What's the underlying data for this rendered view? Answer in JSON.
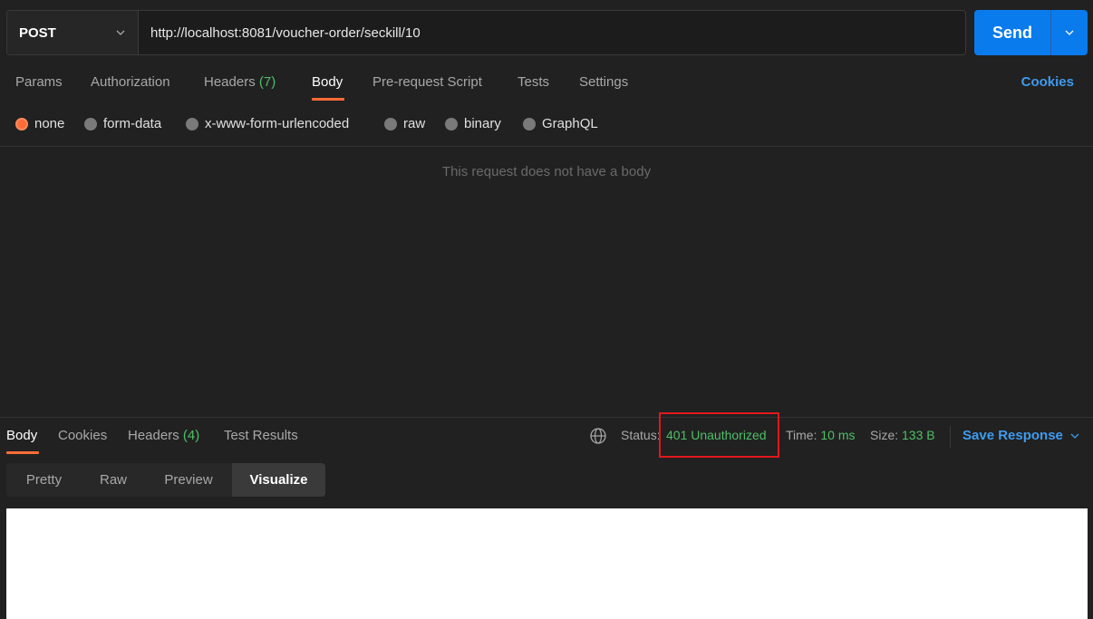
{
  "request": {
    "method": "POST",
    "url": "http://localhost:8081/voucher-order/seckill/10",
    "send_label": "Send"
  },
  "request_tabs": {
    "params": "Params",
    "authorization": "Authorization",
    "headers": "Headers",
    "headers_count": "(7)",
    "body": "Body",
    "prerequest": "Pre-request Script",
    "tests": "Tests",
    "settings": "Settings",
    "cookies": "Cookies"
  },
  "body_types": {
    "none": "none",
    "form_data": "form-data",
    "urlencoded": "x-www-form-urlencoded",
    "raw": "raw",
    "binary": "binary",
    "graphql": "GraphQL",
    "selected": "none"
  },
  "empty_body_message": "This request does not have a body",
  "response_tabs": {
    "body": "Body",
    "cookies": "Cookies",
    "headers": "Headers",
    "headers_count": "(4)",
    "test_results": "Test Results"
  },
  "response_meta": {
    "status_label": "Status:",
    "status_value": "401 Unauthorized",
    "time_label": "Time:",
    "time_value": "10 ms",
    "size_label": "Size:",
    "size_value": "133 B",
    "save_response": "Save Response"
  },
  "view_tabs": {
    "pretty": "Pretty",
    "raw": "Raw",
    "preview": "Preview",
    "visualize": "Visualize",
    "selected": "Visualize"
  },
  "colors": {
    "accent_orange": "#ff6c37",
    "send_blue": "#097bed",
    "link_blue": "#3e9bef",
    "status_green": "#4fbf67",
    "highlight_red": "#e0181b"
  }
}
